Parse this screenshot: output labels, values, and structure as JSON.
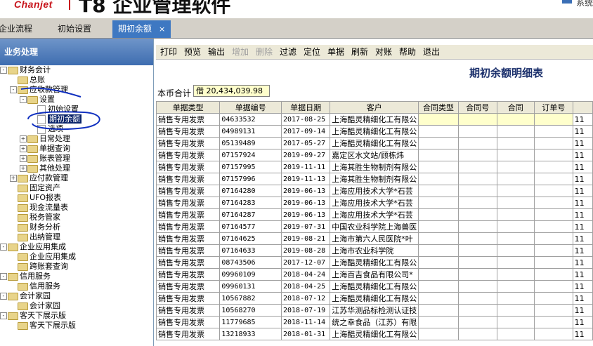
{
  "header": {
    "brand": "Chanjet",
    "title": "T8 企业管理软件",
    "user_label": "系统"
  },
  "tabs": [
    {
      "label": "企业流程"
    },
    {
      "label": "初始设置"
    },
    {
      "label": "期初余额",
      "active": true,
      "close": "×"
    }
  ],
  "sidebar": {
    "title": "业务处理",
    "tree": [
      {
        "label": "财务会计",
        "level": 0,
        "exp": "-",
        "type": "folder"
      },
      {
        "label": "总账",
        "level": 1,
        "exp": "",
        "type": "folder"
      },
      {
        "label": "应收款管理",
        "level": 1,
        "exp": "-",
        "type": "folder"
      },
      {
        "label": "设置",
        "level": 2,
        "exp": "-",
        "type": "folder"
      },
      {
        "label": "初始设置",
        "level": 3,
        "exp": "",
        "type": "doc"
      },
      {
        "label": "期初余额",
        "level": 3,
        "exp": "",
        "type": "doc",
        "selected": true
      },
      {
        "label": "选项",
        "level": 3,
        "exp": "",
        "type": "doc"
      },
      {
        "label": "日常处理",
        "level": 2,
        "exp": "+",
        "type": "folder"
      },
      {
        "label": "单据查询",
        "level": 2,
        "exp": "+",
        "type": "folder"
      },
      {
        "label": "账表管理",
        "level": 2,
        "exp": "+",
        "type": "folder"
      },
      {
        "label": "其他处理",
        "level": 2,
        "exp": "+",
        "type": "folder"
      },
      {
        "label": "应付款管理",
        "level": 1,
        "exp": "+",
        "type": "folder"
      },
      {
        "label": "固定资产",
        "level": 1,
        "exp": "",
        "type": "folder"
      },
      {
        "label": "UFO报表",
        "level": 1,
        "exp": "",
        "type": "folder"
      },
      {
        "label": "现金流量表",
        "level": 1,
        "exp": "",
        "type": "folder"
      },
      {
        "label": "税务管家",
        "level": 1,
        "exp": "",
        "type": "folder"
      },
      {
        "label": "财务分析",
        "level": 1,
        "exp": "",
        "type": "folder"
      },
      {
        "label": "出纳管理",
        "level": 1,
        "exp": "",
        "type": "folder"
      },
      {
        "label": "企业应用集成",
        "level": 0,
        "exp": "-",
        "type": "folder"
      },
      {
        "label": "企业应用集成",
        "level": 1,
        "exp": "",
        "type": "folder"
      },
      {
        "label": "跨账套查询",
        "level": 1,
        "exp": "",
        "type": "folder"
      },
      {
        "label": "信用服务",
        "level": 0,
        "exp": "-",
        "type": "folder"
      },
      {
        "label": "信用服务",
        "level": 1,
        "exp": "",
        "type": "folder"
      },
      {
        "label": "会计家园",
        "level": 0,
        "exp": "-",
        "type": "folder"
      },
      {
        "label": "会计家园",
        "level": 1,
        "exp": "",
        "type": "folder"
      },
      {
        "label": "客天下展示版",
        "level": 0,
        "exp": "-",
        "type": "folder"
      },
      {
        "label": "客天下展示版",
        "level": 1,
        "exp": "",
        "type": "folder"
      }
    ]
  },
  "toolbar": {
    "buttons": [
      {
        "label": "打印"
      },
      {
        "label": "预览"
      },
      {
        "label": "输出"
      },
      {
        "label": "增加",
        "disabled": true
      },
      {
        "label": "删除",
        "disabled": true
      },
      {
        "label": "过滤"
      },
      {
        "label": "定位"
      },
      {
        "label": "单据"
      },
      {
        "label": "刷新"
      },
      {
        "label": "对账"
      },
      {
        "label": "帮助"
      },
      {
        "label": "退出"
      }
    ]
  },
  "report": {
    "title": "期初余额明细表",
    "currency_total_label": "本币合计",
    "currency_total_value": "借 20,434,039.98"
  },
  "grid": {
    "columns": [
      "单据类型",
      "单据编号",
      "单据日期",
      "客户",
      "合同类型",
      "合同号",
      "合同",
      "订单号",
      ""
    ],
    "rows": [
      [
        "销售专用发票",
        "04633532",
        "2017-08-25",
        "上海酷灵精细化工有限公",
        "",
        "",
        "",
        "",
        "11"
      ],
      [
        "销售专用发票",
        "04989131",
        "2017-09-14",
        "上海酷灵精细化工有限公",
        "",
        "",
        "",
        "",
        "11"
      ],
      [
        "销售专用发票",
        "05139489",
        "2017-05-27",
        "上海酷灵精细化工有限公",
        "",
        "",
        "",
        "",
        "11"
      ],
      [
        "销售专用发票",
        "07157924",
        "2019-09-27",
        "嘉定区水文站/顾栋炜",
        "",
        "",
        "",
        "",
        "11"
      ],
      [
        "销售专用发票",
        "07157995",
        "2019-11-11",
        "上海其胜生物制剂有限公",
        "",
        "",
        "",
        "",
        "11"
      ],
      [
        "销售专用发票",
        "07157996",
        "2019-11-13",
        "上海其胜生物制剂有限公",
        "",
        "",
        "",
        "",
        "11"
      ],
      [
        "销售专用发票",
        "07164280",
        "2019-06-13",
        "上海应用技术大学*石芸",
        "",
        "",
        "",
        "",
        "11"
      ],
      [
        "销售专用发票",
        "07164283",
        "2019-06-13",
        "上海应用技术大学*石芸",
        "",
        "",
        "",
        "",
        "11"
      ],
      [
        "销售专用发票",
        "07164287",
        "2019-06-13",
        "上海应用技术大学*石芸",
        "",
        "",
        "",
        "",
        "11"
      ],
      [
        "销售专用发票",
        "07164577",
        "2019-07-31",
        "中国农业科学院上海兽医",
        "",
        "",
        "",
        "",
        "11"
      ],
      [
        "销售专用发票",
        "07164625",
        "2019-08-21",
        "上海市第六人民医院*叶",
        "",
        "",
        "",
        "",
        "11"
      ],
      [
        "销售专用发票",
        "07164633",
        "2019-08-28",
        "上海市农业科学院",
        "",
        "",
        "",
        "",
        "11"
      ],
      [
        "销售专用发票",
        "08743506",
        "2017-12-07",
        "上海酷灵精细化工有限公",
        "",
        "",
        "",
        "",
        "11"
      ],
      [
        "销售专用发票",
        "09960109",
        "2018-04-24",
        "上海百吉食品有限公司*",
        "",
        "",
        "",
        "",
        "11"
      ],
      [
        "销售专用发票",
        "09960131",
        "2018-04-25",
        "上海酷灵精细化工有限公",
        "",
        "",
        "",
        "",
        "11"
      ],
      [
        "销售专用发票",
        "10567882",
        "2018-07-12",
        "上海酷灵精细化工有限公",
        "",
        "",
        "",
        "",
        "11"
      ],
      [
        "销售专用发票",
        "10568270",
        "2018-07-19",
        "江苏华测品标检测认证技",
        "",
        "",
        "",
        "",
        "11"
      ],
      [
        "销售专用发票",
        "11779685",
        "2018-11-14",
        "统之幸食品（江苏）有限",
        "",
        "",
        "",
        "",
        "11"
      ],
      [
        "销售专用发票",
        "13218933",
        "2018-01-31",
        "上海酷灵精细化工有限公",
        "",
        "",
        "",
        "",
        "11"
      ]
    ]
  }
}
